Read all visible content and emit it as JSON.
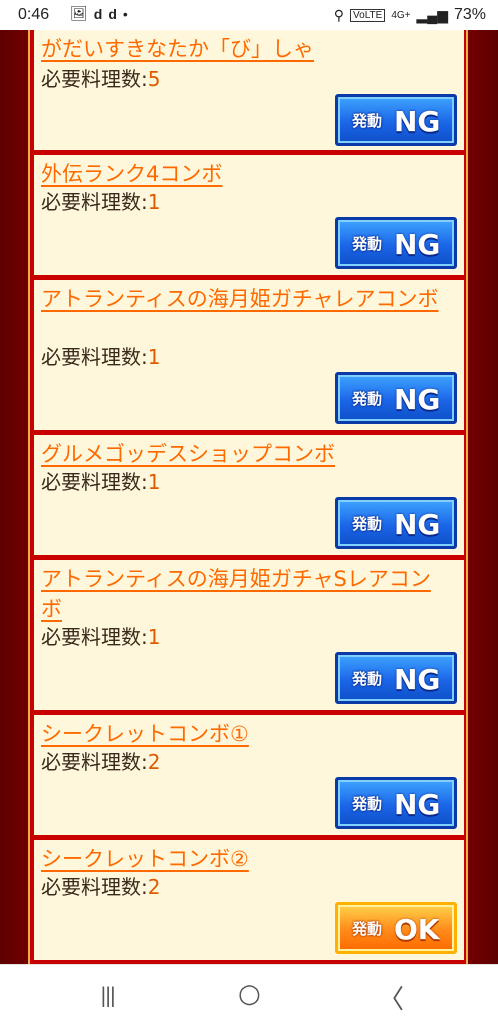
{
  "status_bar": {
    "time": "0:46",
    "left_icons": [
      "image-icon",
      "d-app-icon",
      "d-app-icon",
      "dot-icon"
    ],
    "network": "4G+",
    "battery": "73%"
  },
  "cards": [
    {
      "title": "がだいすきなたか「び」しゃ",
      "count_label": "必要料理数:",
      "count": "5",
      "button_kanji": "発動",
      "button_word": "NG",
      "state": "ng"
    },
    {
      "title": "外伝ランク4コンボ",
      "count_label": "必要料理数:",
      "count": "1",
      "button_kanji": "発動",
      "button_word": "NG",
      "state": "ng"
    },
    {
      "title": "アトランティスの海月姫ガチャレアコンボ",
      "count_label": "必要料理数:",
      "count": "1",
      "button_kanji": "発動",
      "button_word": "NG",
      "state": "ng"
    },
    {
      "title": "グルメゴッデスショップコンボ",
      "count_label": "必要料理数:",
      "count": "1",
      "button_kanji": "発動",
      "button_word": "NG",
      "state": "ng"
    },
    {
      "title": "アトランティスの海月姫ガチャSレアコンボ",
      "count_label": "必要料理数:",
      "count": "1",
      "button_kanji": "発動",
      "button_word": "NG",
      "state": "ng"
    },
    {
      "title": "シークレットコンボ①",
      "count_label": "必要料理数:",
      "count": "2",
      "button_kanji": "発動",
      "button_word": "NG",
      "state": "ng"
    },
    {
      "title": "シークレットコンボ②",
      "count_label": "必要料理数:",
      "count": "2",
      "button_kanji": "発動",
      "button_word": "OK",
      "state": "ok"
    }
  ],
  "nav": {
    "recent": "|||",
    "home": "○",
    "back": "〈"
  },
  "colors": {
    "link": "#ff6a00",
    "card_bg": "#fff7dc",
    "panel": "#c90000",
    "ng_button": "#1b66e8",
    "ok_button": "#ff8a1a"
  }
}
